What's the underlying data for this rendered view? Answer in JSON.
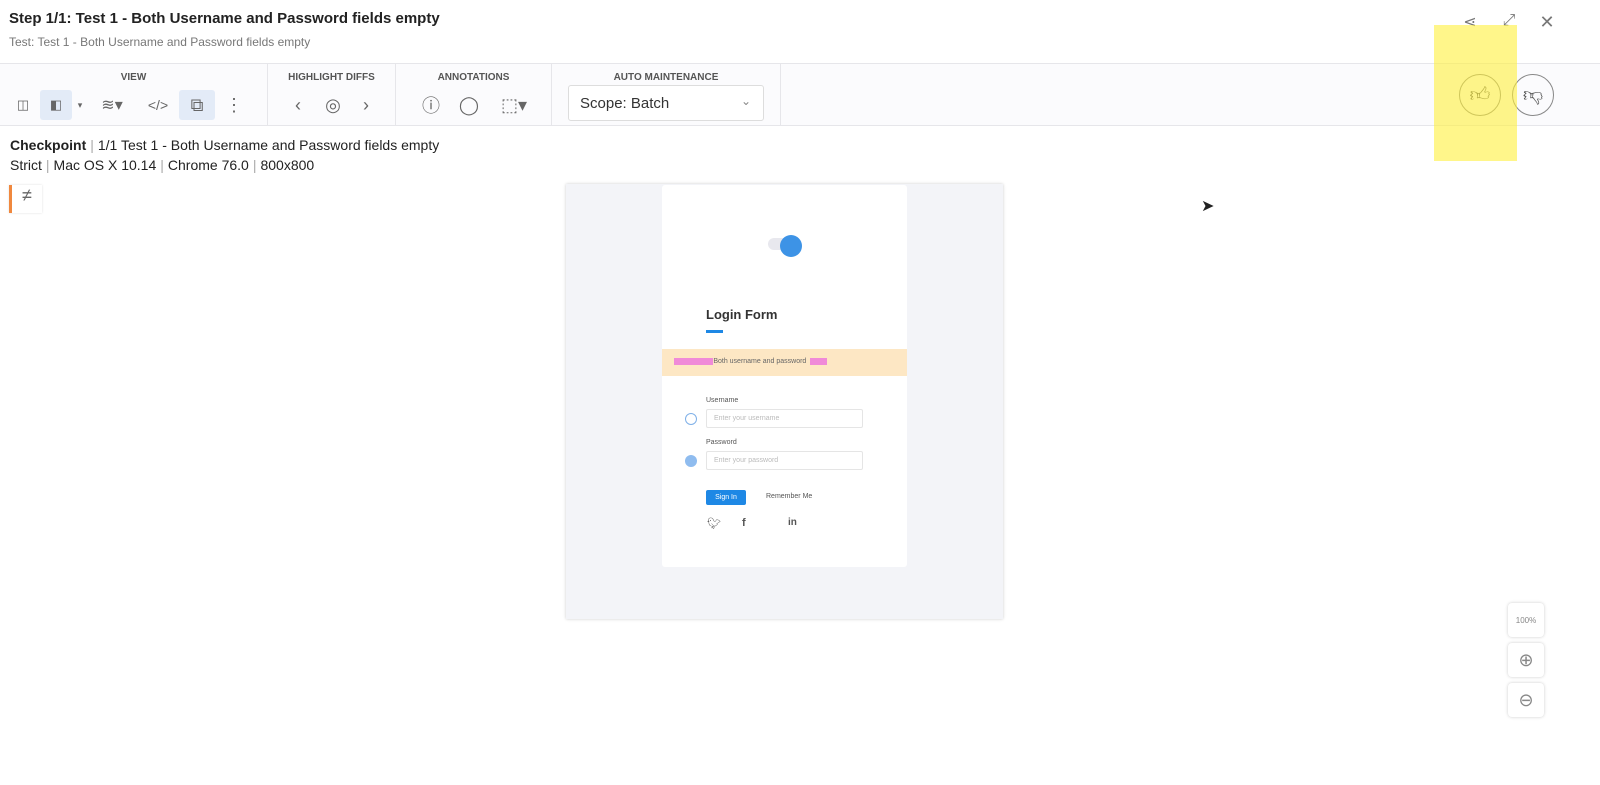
{
  "header": {
    "title": "Step 1/1: Test 1 - Both Username and Password fields empty",
    "subtitle": "Test: Test 1 - Both Username and Password fields empty"
  },
  "toolbar": {
    "view_label": "VIEW",
    "highlight_label": "HIGHLIGHT DIFFS",
    "annotations_label": "ANNOTATIONS",
    "auto_label": "AUTO MAINTENANCE",
    "scope_value": "Scope: Batch"
  },
  "checkpoint": {
    "label": "Checkpoint",
    "name": "1/1 Test 1 - Both Username and Password fields empty",
    "match_level": "Strict",
    "os": "Mac OS X 10.14",
    "browser": "Chrome 76.0",
    "viewport": "800x800",
    "diff_symbol": "≠"
  },
  "screenshot": {
    "form_title": "Login Form",
    "alert_text": "Both username and password",
    "username_label": "Username",
    "username_placeholder": "Enter your username",
    "password_label": "Password",
    "password_placeholder": "Enter your password",
    "signin_label": "Sign In",
    "remember_label": "Remember Me"
  },
  "zoom": {
    "fit_label": "100%"
  },
  "colors": {
    "accent": "#1e88e5",
    "highlight": "#fff03c",
    "diff_marker": "#f0883e"
  }
}
